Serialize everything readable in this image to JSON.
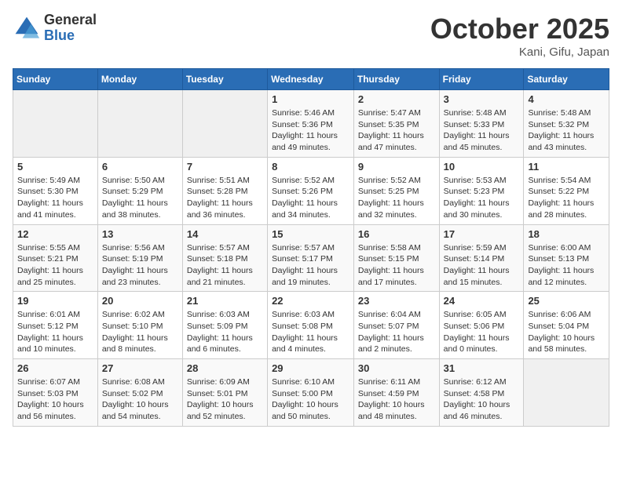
{
  "logo": {
    "general": "General",
    "blue": "Blue"
  },
  "title": {
    "month": "October 2025",
    "location": "Kani, Gifu, Japan"
  },
  "weekdays": [
    "Sunday",
    "Monday",
    "Tuesday",
    "Wednesday",
    "Thursday",
    "Friday",
    "Saturday"
  ],
  "weeks": [
    [
      {
        "day": "",
        "info": ""
      },
      {
        "day": "",
        "info": ""
      },
      {
        "day": "",
        "info": ""
      },
      {
        "day": "1",
        "info": "Sunrise: 5:46 AM\nSunset: 5:36 PM\nDaylight: 11 hours\nand 49 minutes."
      },
      {
        "day": "2",
        "info": "Sunrise: 5:47 AM\nSunset: 5:35 PM\nDaylight: 11 hours\nand 47 minutes."
      },
      {
        "day": "3",
        "info": "Sunrise: 5:48 AM\nSunset: 5:33 PM\nDaylight: 11 hours\nand 45 minutes."
      },
      {
        "day": "4",
        "info": "Sunrise: 5:48 AM\nSunset: 5:32 PM\nDaylight: 11 hours\nand 43 minutes."
      }
    ],
    [
      {
        "day": "5",
        "info": "Sunrise: 5:49 AM\nSunset: 5:30 PM\nDaylight: 11 hours\nand 41 minutes."
      },
      {
        "day": "6",
        "info": "Sunrise: 5:50 AM\nSunset: 5:29 PM\nDaylight: 11 hours\nand 38 minutes."
      },
      {
        "day": "7",
        "info": "Sunrise: 5:51 AM\nSunset: 5:28 PM\nDaylight: 11 hours\nand 36 minutes."
      },
      {
        "day": "8",
        "info": "Sunrise: 5:52 AM\nSunset: 5:26 PM\nDaylight: 11 hours\nand 34 minutes."
      },
      {
        "day": "9",
        "info": "Sunrise: 5:52 AM\nSunset: 5:25 PM\nDaylight: 11 hours\nand 32 minutes."
      },
      {
        "day": "10",
        "info": "Sunrise: 5:53 AM\nSunset: 5:23 PM\nDaylight: 11 hours\nand 30 minutes."
      },
      {
        "day": "11",
        "info": "Sunrise: 5:54 AM\nSunset: 5:22 PM\nDaylight: 11 hours\nand 28 minutes."
      }
    ],
    [
      {
        "day": "12",
        "info": "Sunrise: 5:55 AM\nSunset: 5:21 PM\nDaylight: 11 hours\nand 25 minutes."
      },
      {
        "day": "13",
        "info": "Sunrise: 5:56 AM\nSunset: 5:19 PM\nDaylight: 11 hours\nand 23 minutes."
      },
      {
        "day": "14",
        "info": "Sunrise: 5:57 AM\nSunset: 5:18 PM\nDaylight: 11 hours\nand 21 minutes."
      },
      {
        "day": "15",
        "info": "Sunrise: 5:57 AM\nSunset: 5:17 PM\nDaylight: 11 hours\nand 19 minutes."
      },
      {
        "day": "16",
        "info": "Sunrise: 5:58 AM\nSunset: 5:15 PM\nDaylight: 11 hours\nand 17 minutes."
      },
      {
        "day": "17",
        "info": "Sunrise: 5:59 AM\nSunset: 5:14 PM\nDaylight: 11 hours\nand 15 minutes."
      },
      {
        "day": "18",
        "info": "Sunrise: 6:00 AM\nSunset: 5:13 PM\nDaylight: 11 hours\nand 12 minutes."
      }
    ],
    [
      {
        "day": "19",
        "info": "Sunrise: 6:01 AM\nSunset: 5:12 PM\nDaylight: 11 hours\nand 10 minutes."
      },
      {
        "day": "20",
        "info": "Sunrise: 6:02 AM\nSunset: 5:10 PM\nDaylight: 11 hours\nand 8 minutes."
      },
      {
        "day": "21",
        "info": "Sunrise: 6:03 AM\nSunset: 5:09 PM\nDaylight: 11 hours\nand 6 minutes."
      },
      {
        "day": "22",
        "info": "Sunrise: 6:03 AM\nSunset: 5:08 PM\nDaylight: 11 hours\nand 4 minutes."
      },
      {
        "day": "23",
        "info": "Sunrise: 6:04 AM\nSunset: 5:07 PM\nDaylight: 11 hours\nand 2 minutes."
      },
      {
        "day": "24",
        "info": "Sunrise: 6:05 AM\nSunset: 5:06 PM\nDaylight: 11 hours\nand 0 minutes."
      },
      {
        "day": "25",
        "info": "Sunrise: 6:06 AM\nSunset: 5:04 PM\nDaylight: 10 hours\nand 58 minutes."
      }
    ],
    [
      {
        "day": "26",
        "info": "Sunrise: 6:07 AM\nSunset: 5:03 PM\nDaylight: 10 hours\nand 56 minutes."
      },
      {
        "day": "27",
        "info": "Sunrise: 6:08 AM\nSunset: 5:02 PM\nDaylight: 10 hours\nand 54 minutes."
      },
      {
        "day": "28",
        "info": "Sunrise: 6:09 AM\nSunset: 5:01 PM\nDaylight: 10 hours\nand 52 minutes."
      },
      {
        "day": "29",
        "info": "Sunrise: 6:10 AM\nSunset: 5:00 PM\nDaylight: 10 hours\nand 50 minutes."
      },
      {
        "day": "30",
        "info": "Sunrise: 6:11 AM\nSunset: 4:59 PM\nDaylight: 10 hours\nand 48 minutes."
      },
      {
        "day": "31",
        "info": "Sunrise: 6:12 AM\nSunset: 4:58 PM\nDaylight: 10 hours\nand 46 minutes."
      },
      {
        "day": "",
        "info": ""
      }
    ]
  ]
}
